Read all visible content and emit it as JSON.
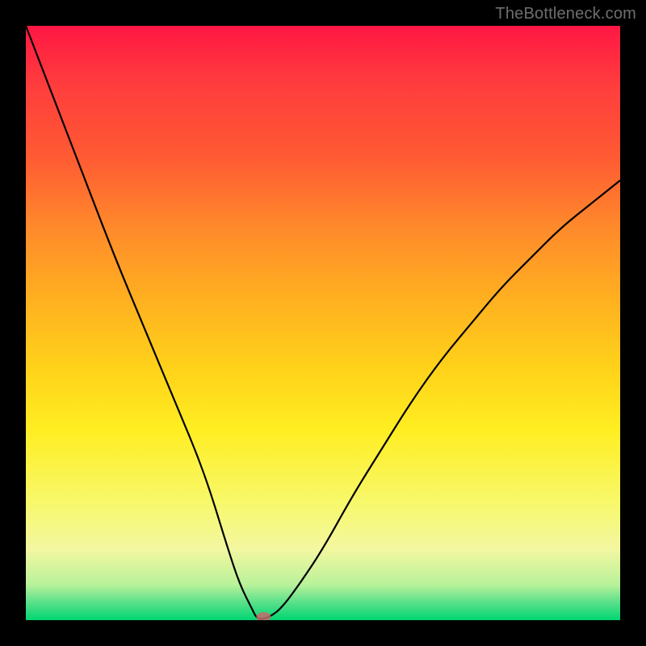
{
  "watermark": "TheBottleneck.com",
  "chart_data": {
    "type": "line",
    "title": "",
    "xlabel": "",
    "ylabel": "",
    "xlim": [
      0,
      100
    ],
    "ylim": [
      0,
      100
    ],
    "grid": false,
    "legend": false,
    "x": [
      0,
      5,
      10,
      15,
      20,
      25,
      30,
      34,
      36,
      38,
      39,
      41,
      43,
      46,
      50,
      55,
      60,
      65,
      70,
      75,
      80,
      85,
      90,
      95,
      100
    ],
    "values": [
      100,
      87,
      74,
      61,
      49,
      37,
      25,
      12,
      6,
      2,
      0,
      0.5,
      2,
      6,
      12,
      21,
      29,
      37,
      44,
      50,
      56,
      61,
      66,
      70,
      74
    ],
    "marker": {
      "x": 40,
      "y": 0,
      "shape": "ellipse"
    },
    "background": {
      "type": "vertical-gradient",
      "stops": [
        {
          "pos": 0.0,
          "color": "#ff1744"
        },
        {
          "pos": 0.1,
          "color": "#ff3d3d"
        },
        {
          "pos": 0.22,
          "color": "#ff5a33"
        },
        {
          "pos": 0.34,
          "color": "#ff8a2b"
        },
        {
          "pos": 0.46,
          "color": "#ffb020"
        },
        {
          "pos": 0.58,
          "color": "#ffd31a"
        },
        {
          "pos": 0.68,
          "color": "#ffee22"
        },
        {
          "pos": 0.8,
          "color": "#f8f86a"
        },
        {
          "pos": 0.88,
          "color": "#f3f7a0"
        },
        {
          "pos": 0.94,
          "color": "#b9f29a"
        },
        {
          "pos": 0.97,
          "color": "#5ae08a"
        },
        {
          "pos": 1.0,
          "color": "#00d672"
        }
      ]
    }
  }
}
